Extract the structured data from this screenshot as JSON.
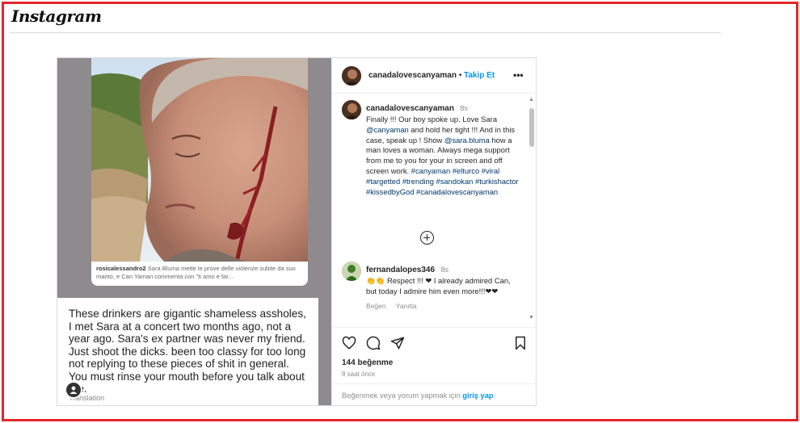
{
  "app": {
    "logo": "Instagram"
  },
  "media": {
    "caption_user": "rosicalessandro2",
    "caption_text": "Sara Bluma mette le prove delle violenze subite da suo marito, e Can Yaman commenta con \"ti amo e far...",
    "quote": "These drinkers are gigantic shameless assholes, I met Sara at a concert two months ago, not a year ago. Sara's ex partner was never my friend. Just shoot the dicks. been too classy for too long not replying to these pieces of shit in general. You must rinse your mouth before you talk about me.",
    "translation_label": "Translation"
  },
  "header": {
    "username": "canadalovescanyaman",
    "separator": "•",
    "follow_label": "Takip Et",
    "more_label": "•••"
  },
  "caption": {
    "username": "canadalovescanyaman",
    "time": "8s",
    "text_1": "Finally !!! Our boy spoke up. Love Sara ",
    "mention_1": "@canyaman",
    "text_2": " and hold her tight !!! And in this case, speak up ! Show ",
    "mention_2": "@sara.bluma",
    "text_3": " how a man loves a woman. Always mega support from me to you for your in screen and off screen work. ",
    "hashtags": "#canyaman #elturco #viral #targetted #trending #sandokan #turkishactor #kissedbyGod #canadalovescanyaman"
  },
  "comment": {
    "username": "fernandalopes346",
    "time": "8s",
    "text": "👏👏 Respect !!! ❤ I already admired Can, but today I admire him even more!!!❤❤",
    "like_label": "Beğen",
    "reply_label": "Yanıtla"
  },
  "actions": {
    "likes": "144 beğenme",
    "time_ago": "8 saat önce"
  },
  "login": {
    "prefix": "Beğenmek veya yorum yapmak için ",
    "link": "giriş yap",
    "suffix": "."
  },
  "colors": {
    "accent": "#0095f6",
    "frame": "#e4262b",
    "link": "#00376b"
  }
}
